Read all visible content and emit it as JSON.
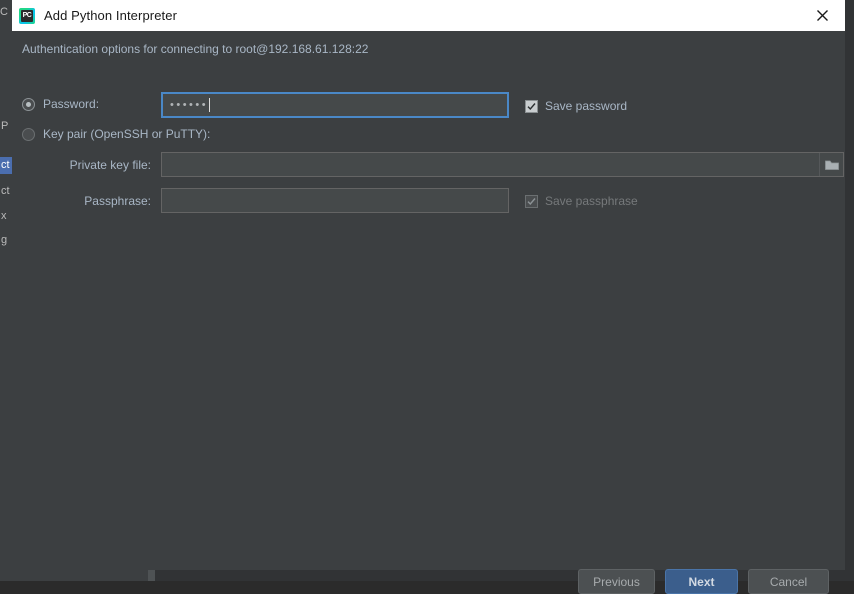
{
  "window": {
    "title": "Add Python Interpreter",
    "app_icon": "pycharm-icon",
    "icon_text": "PC",
    "close_icon": "close-icon"
  },
  "dialog": {
    "description": "Authentication options for connecting to root@192.168.61.128:22",
    "auth_mode": {
      "password_option": {
        "label": "Password:",
        "selected": true,
        "value": "••••••",
        "save_label": "Save password",
        "save_checked": true
      },
      "keypair_option": {
        "label": "Key pair (OpenSSH or PuTTY):",
        "selected": false
      }
    },
    "private_key": {
      "label": "Private key file:",
      "value": "",
      "browse_icon": "folder-icon"
    },
    "passphrase": {
      "label": "Passphrase:",
      "value": "",
      "save_label": "Save passphrase",
      "save_checked": true,
      "disabled": true
    }
  },
  "footer": {
    "previous_label": "Previous",
    "next_label": "Next",
    "cancel_label": "Cancel"
  },
  "background": {
    "sidebar_fragments": [
      "C",
      "P",
      "ct",
      "ct",
      "x",
      "g"
    ]
  },
  "colors": {
    "accent": "#3b5e8c",
    "focus_border": "#4a88c7",
    "dialog_bg": "#3c3f41",
    "text": "#a9b7c6",
    "selection": "#4b6eaf"
  }
}
